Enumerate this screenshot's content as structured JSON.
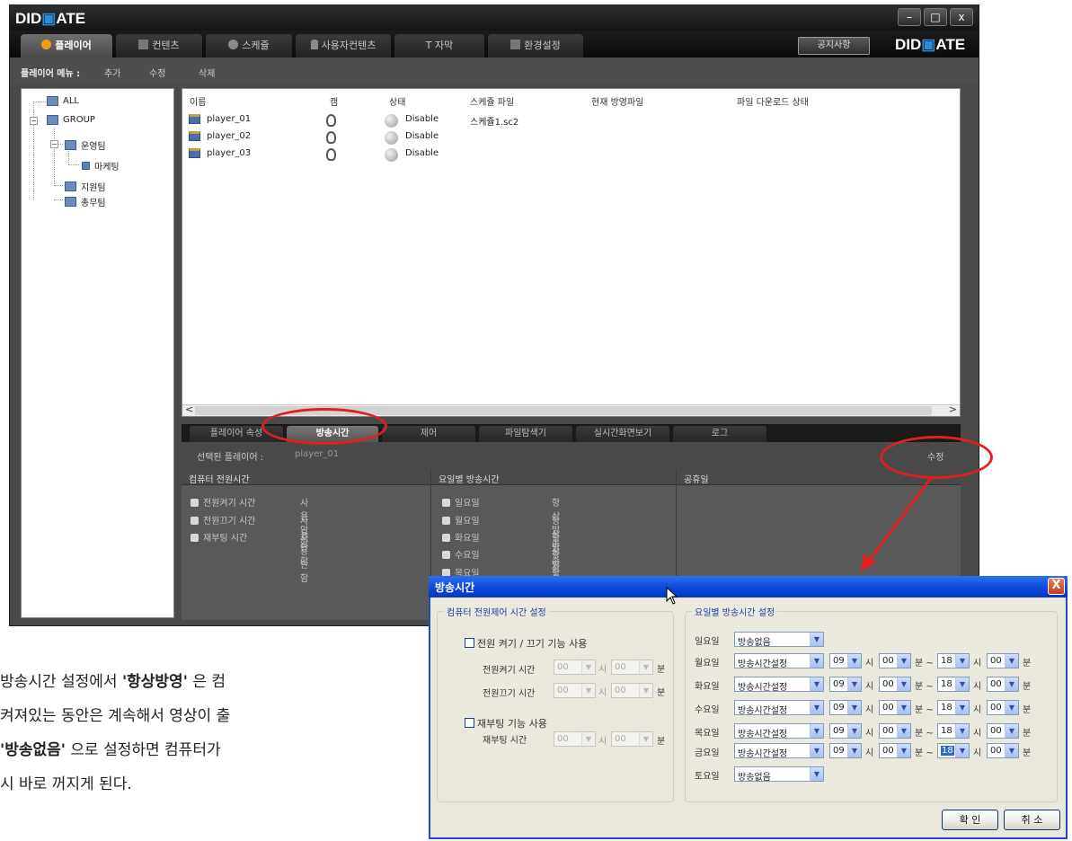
{
  "app": {
    "logo_text": "DIDMATE",
    "logo_parts": [
      "DID",
      "ATE"
    ],
    "window_buttons": {
      "minimize": "–",
      "maximize": "□",
      "close": "x"
    },
    "main_tabs": [
      {
        "label": "플레이어",
        "active": true,
        "icon": "play-icon"
      },
      {
        "label": "컨텐츠",
        "active": false,
        "icon": "film-icon"
      },
      {
        "label": "스케쥴",
        "active": false,
        "icon": "clock-icon"
      },
      {
        "label": "사용자컨텐츠",
        "active": false,
        "icon": "user-icon"
      },
      {
        "label": "T  자막",
        "active": false,
        "icon": "text-icon"
      },
      {
        "label": "환경설정",
        "active": false,
        "icon": "settings-icon"
      }
    ],
    "notice_button": "공지사항",
    "menu": {
      "title": "플레이어 메뉴 :",
      "items": [
        "추가",
        "수정",
        "삭제"
      ]
    },
    "tree": {
      "items": [
        {
          "label": "ALL"
        },
        {
          "label": "GROUP"
        },
        {
          "label": "운영팀"
        },
        {
          "label": "마케팅"
        },
        {
          "label": "지원팀"
        },
        {
          "label": "총무팀"
        }
      ]
    },
    "player_list": {
      "columns": [
        "이름",
        "캠",
        "상태",
        "스케쥴 파일",
        "현재 방영파일",
        "파일 다운로드 상태"
      ],
      "rows": [
        {
          "name": "player_01",
          "status": "Disable",
          "schedule": "스케쥴1.sc2"
        },
        {
          "name": "player_02",
          "status": "Disable",
          "schedule": ""
        },
        {
          "name": "player_03",
          "status": "Disable",
          "schedule": ""
        }
      ],
      "scroll_left": "<",
      "scroll_right": ">"
    },
    "sub_tabs": [
      {
        "label": "플레이어 속성",
        "active": false
      },
      {
        "label": "방송시간",
        "active": true
      },
      {
        "label": "제어",
        "active": false
      },
      {
        "label": "파일탐색기",
        "active": false
      },
      {
        "label": "실시간화면보기",
        "active": false
      },
      {
        "label": "로그",
        "active": false
      }
    ],
    "selected_player": {
      "label": "선택된 플레이어 :",
      "value": "player_01",
      "edit": "수정"
    },
    "grid": {
      "power_header": "컴퓨터 전원시간",
      "weekly_header": "요일별 방송시간",
      "holiday_header": "공휴일",
      "power_items": [
        {
          "label": "전원켜기 시간",
          "value": "사용안함"
        },
        {
          "label": "전원끄기 시간",
          "value": "사용안함"
        },
        {
          "label": "재부팅  시간",
          "value": "사용안함"
        }
      ],
      "weekly_items": [
        {
          "label": "일요일",
          "value": "항상방송"
        },
        {
          "label": "월요일",
          "value": "항상방송"
        },
        {
          "label": "화요일",
          "value": "항상방송"
        },
        {
          "label": "수요일",
          "value": "항상방송"
        },
        {
          "label": "목요일",
          "value": "항상방송"
        }
      ]
    }
  },
  "dialog": {
    "title": "방송시간",
    "close": "X",
    "power_group": {
      "legend": "컴퓨터 전원제어 시간 설정",
      "enable_power": "전원 켜기 / 끄기 기능 사용",
      "power_on_label": "전원켜기 시간",
      "power_off_label": "전원끄기 시간",
      "enable_reboot": "재부팅 기능 사용",
      "reboot_label": "재부팅 시간",
      "hour_value": "00",
      "minute_value": "00",
      "hour_unit": "시",
      "minute_unit": "분"
    },
    "weekly_group": {
      "legend": "요일별 방송시간 설정",
      "hour_unit": "시",
      "minute_unit": "분",
      "tilde": "분 ~",
      "days": [
        {
          "day": "일요일",
          "mode": "방송없음",
          "times": null
        },
        {
          "day": "월요일",
          "mode": "방송시간설정",
          "times": [
            "09",
            "00",
            "18",
            "00"
          ]
        },
        {
          "day": "화요일",
          "mode": "방송시간설정",
          "times": [
            "09",
            "00",
            "18",
            "00"
          ]
        },
        {
          "day": "수요일",
          "mode": "방송시간설정",
          "times": [
            "09",
            "00",
            "18",
            "00"
          ]
        },
        {
          "day": "목요일",
          "mode": "방송시간설정",
          "times": [
            "09",
            "00",
            "18",
            "00"
          ]
        },
        {
          "day": "금요일",
          "mode": "방송시간설정",
          "times": [
            "09",
            "00",
            "18",
            "00"
          ]
        },
        {
          "day": "토요일",
          "mode": "방송없음",
          "times": null
        }
      ]
    },
    "ok": "확 인",
    "cancel": "취 소"
  },
  "body_text": {
    "line1_a": "방송시간 설정에서 ",
    "line1_b": "'항상방영'",
    "line1_c": " 은 컴",
    "line2": "켜져있는 동안은 계속해서 영상이 출",
    "line3_a": "'방송없음'",
    "line3_b": " 으로 설정하면 컴퓨터가",
    "line4": "시 바로 꺼지게 된다."
  },
  "colors": {
    "annotation_red": "#e02020",
    "dialog_title_blue": "#0a46d8",
    "accent_orange": "#f39c12"
  }
}
